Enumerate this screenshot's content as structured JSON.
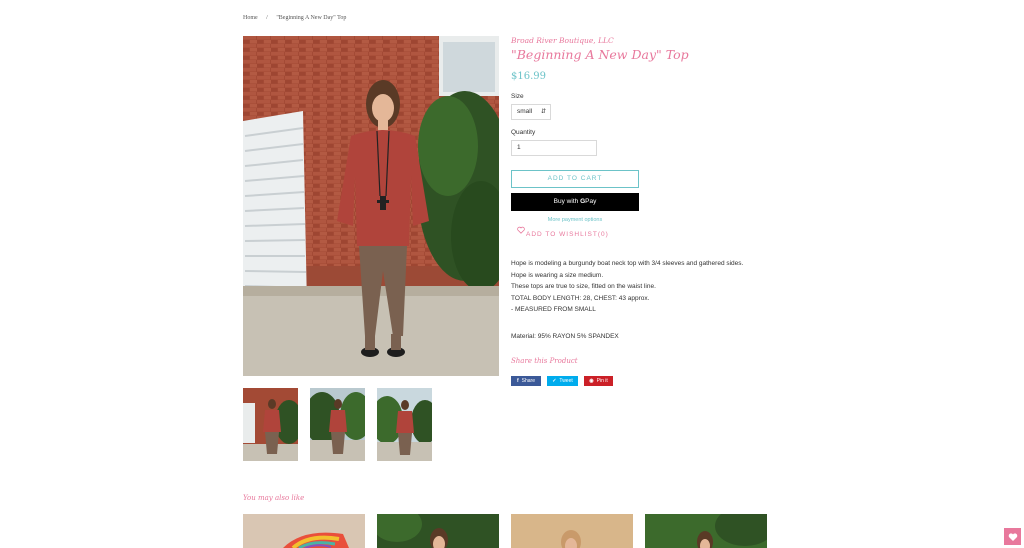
{
  "breadcrumb": {
    "home": "Home",
    "separator": "/",
    "current": "\"Beginning A New Day\" Top"
  },
  "product": {
    "vendor": "Broad River Boutique, LLC",
    "title": "\"Beginning A New Day\" Top",
    "price": "$16.99",
    "size_label": "Size",
    "size_value": "small",
    "quantity_label": "Quantity",
    "quantity_value": "1",
    "add_to_cart": "ADD TO CART",
    "buy_with": "Buy with",
    "gpay_g": "G",
    "gpay_pay": "Pay",
    "more_payment": "More payment options",
    "wishlist": "ADD TO WISHLIST(0)",
    "description": [
      "Hope is modeling a burgundy boat neck top with 3/4 sleeves and gathered sides.",
      "Hope is wearing a size medium.",
      "These tops are true to size, fitted on the waist line.",
      "TOTAL BODY LENGTH: 28, CHEST: 43 approx.",
      "- MEASURED FROM SMALL"
    ],
    "material": "Material: 95% RAYON 5% SPANDEX"
  },
  "share": {
    "heading": "Share this Product",
    "facebook": "Share",
    "twitter": "Tweet",
    "pinterest": "Pin it"
  },
  "related": {
    "heading": "You may also like"
  },
  "colors": {
    "accent_pink": "#e8789c",
    "accent_teal": "#6cc3c8",
    "facebook": "#3b5998",
    "twitter": "#00aced",
    "pinterest": "#cb2027"
  },
  "icons": {
    "wishlist": "heart-outline-icon",
    "floating": "heart-icon"
  }
}
